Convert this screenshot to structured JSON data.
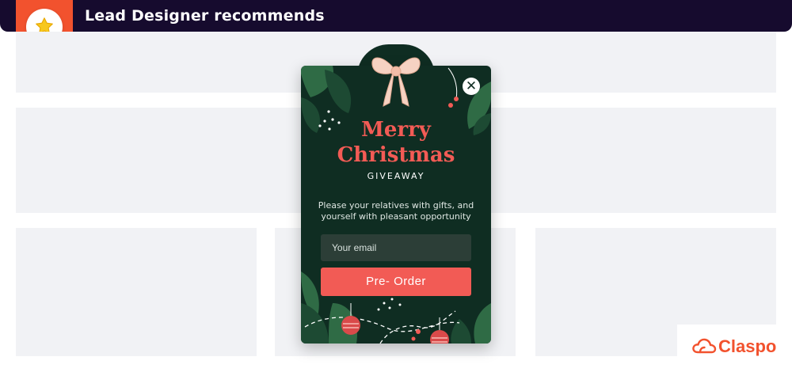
{
  "header": {
    "title": "Lead Designer recommends"
  },
  "popup": {
    "title_line1": "Merry",
    "title_line2": "Christmas",
    "subtitle": "GIVEAWAY",
    "description": "Please your relatives with gifts, and yourself with pleasant opportunity",
    "email_placeholder": "Your email",
    "email_value": "",
    "button_label": "Pre- Order",
    "close_symbol": "✕"
  },
  "brand": {
    "name": "Claspo"
  },
  "icons": [
    "star-icon",
    "bow-icon",
    "close-icon",
    "cloud-logo-icon"
  ],
  "colors": {
    "header_bg": "#160b2e",
    "ribbon": "#f2522e",
    "popup_bg": "#0f2d22",
    "accent": "#f25b55",
    "placeholder_block": "#f1f2f5",
    "brand": "#f2522e"
  }
}
